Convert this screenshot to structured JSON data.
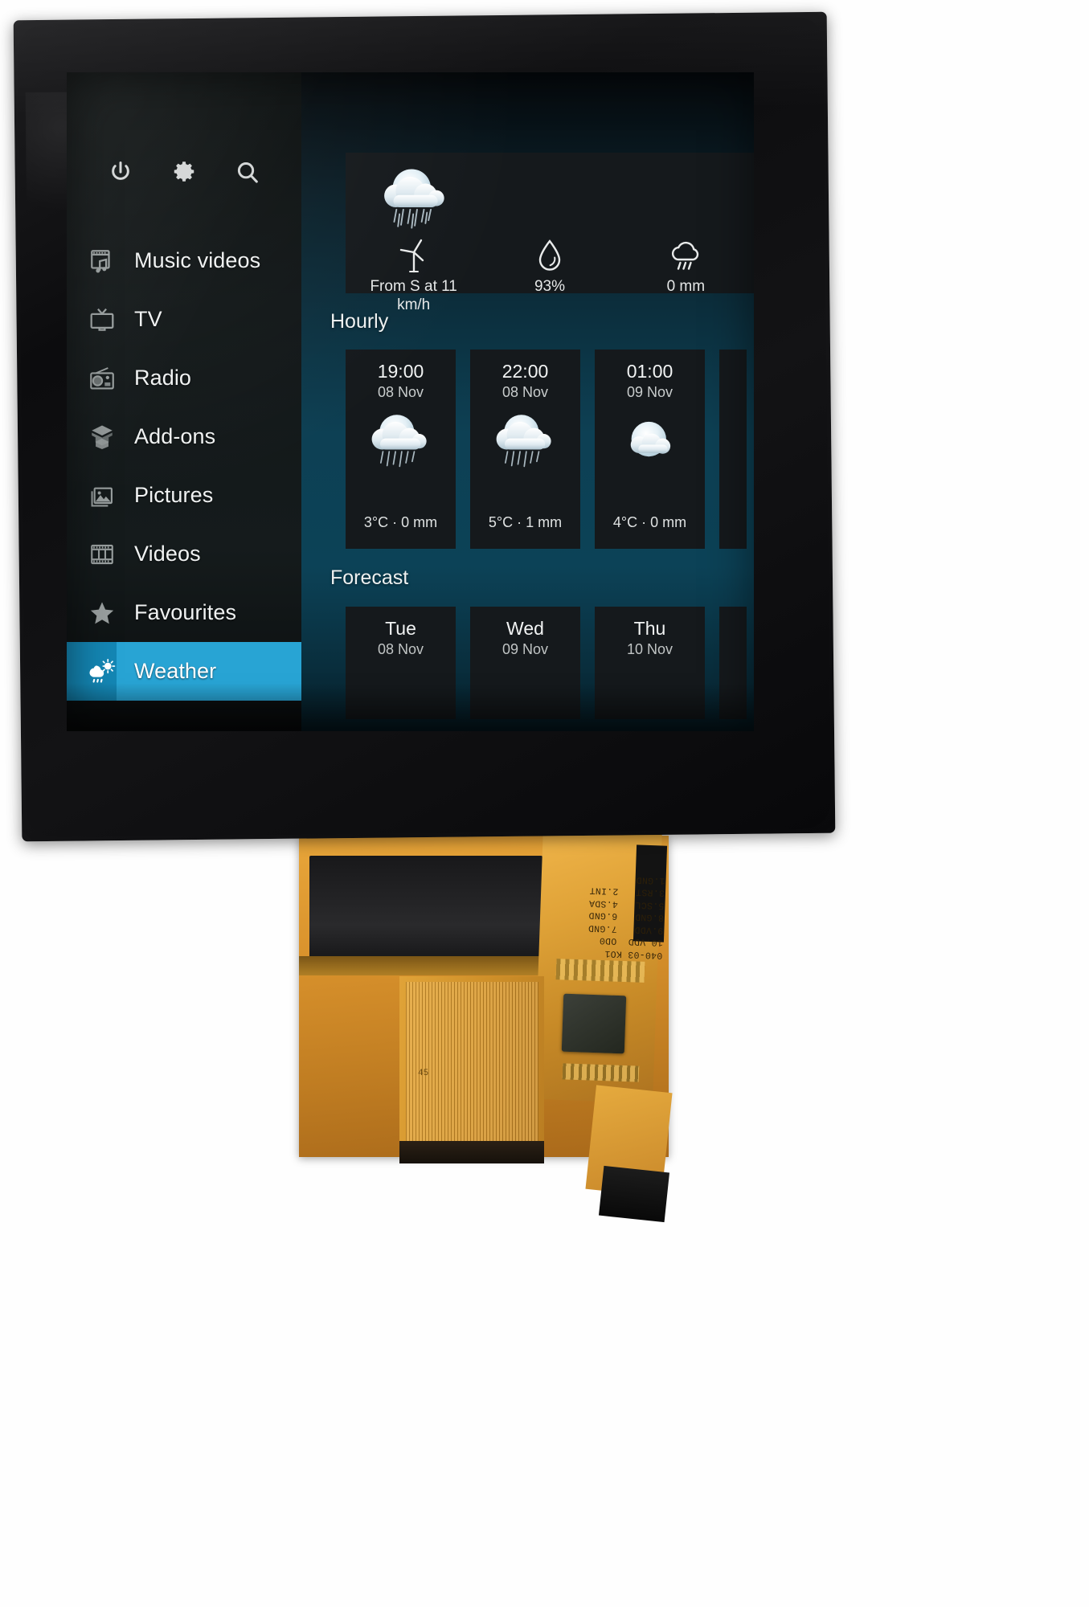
{
  "device": {
    "ribbon_label": "040-03 KO1\n10.VDD  OD0\n9.VDD   7.GND\n8.GND   6.GND\n5.SCL   4.SDA\n3.RST   2.INT\n1.GND",
    "ribbon_number": "45"
  },
  "sidebar": {
    "toolbar": [
      {
        "name": "power-icon",
        "label": "Power"
      },
      {
        "name": "settings-icon",
        "label": "Settings"
      },
      {
        "name": "search-icon",
        "label": "Search"
      }
    ],
    "items": [
      {
        "label": "Music videos",
        "icon": "music-video-icon",
        "active": false
      },
      {
        "label": "TV",
        "icon": "tv-icon",
        "active": false
      },
      {
        "label": "Radio",
        "icon": "radio-icon",
        "active": false
      },
      {
        "label": "Add-ons",
        "icon": "addons-box-icon",
        "active": false
      },
      {
        "label": "Pictures",
        "icon": "pictures-icon",
        "active": false
      },
      {
        "label": "Videos",
        "icon": "film-strip-icon",
        "active": false
      },
      {
        "label": "Favourites",
        "icon": "star-icon",
        "active": false
      },
      {
        "label": "Weather",
        "icon": "weather-cloud-sun-rain-icon",
        "active": true
      }
    ],
    "accent_color": "#28a4d4",
    "accent_dark_color": "#1487b5"
  },
  "weather": {
    "current": {
      "condition_icon": "cloud-moon-rain-icon",
      "stats": [
        {
          "icon": "wind-turbine-icon",
          "value": "From S at 11 km/h"
        },
        {
          "icon": "humidity-droplet-icon",
          "value": "93%"
        },
        {
          "icon": "rain-cloud-icon",
          "value": "0 mm"
        }
      ]
    },
    "hourly_title": "Hourly",
    "hourly": [
      {
        "time": "19:00",
        "date": "08 Nov",
        "icon": "cloud-moon-rain-icon",
        "value": "3°C · 0 mm"
      },
      {
        "time": "22:00",
        "date": "08 Nov",
        "icon": "cloud-moon-rain-icon",
        "value": "5°C · 1 mm"
      },
      {
        "time": "01:00",
        "date": "09 Nov",
        "icon": "moon-cloud-icon",
        "value": "4°C · 0 mm"
      }
    ],
    "forecast_title": "Forecast",
    "forecast": [
      {
        "day": "Tue",
        "date": "08 Nov"
      },
      {
        "day": "Wed",
        "date": "09 Nov"
      },
      {
        "day": "Thu",
        "date": "10 Nov"
      }
    ]
  }
}
